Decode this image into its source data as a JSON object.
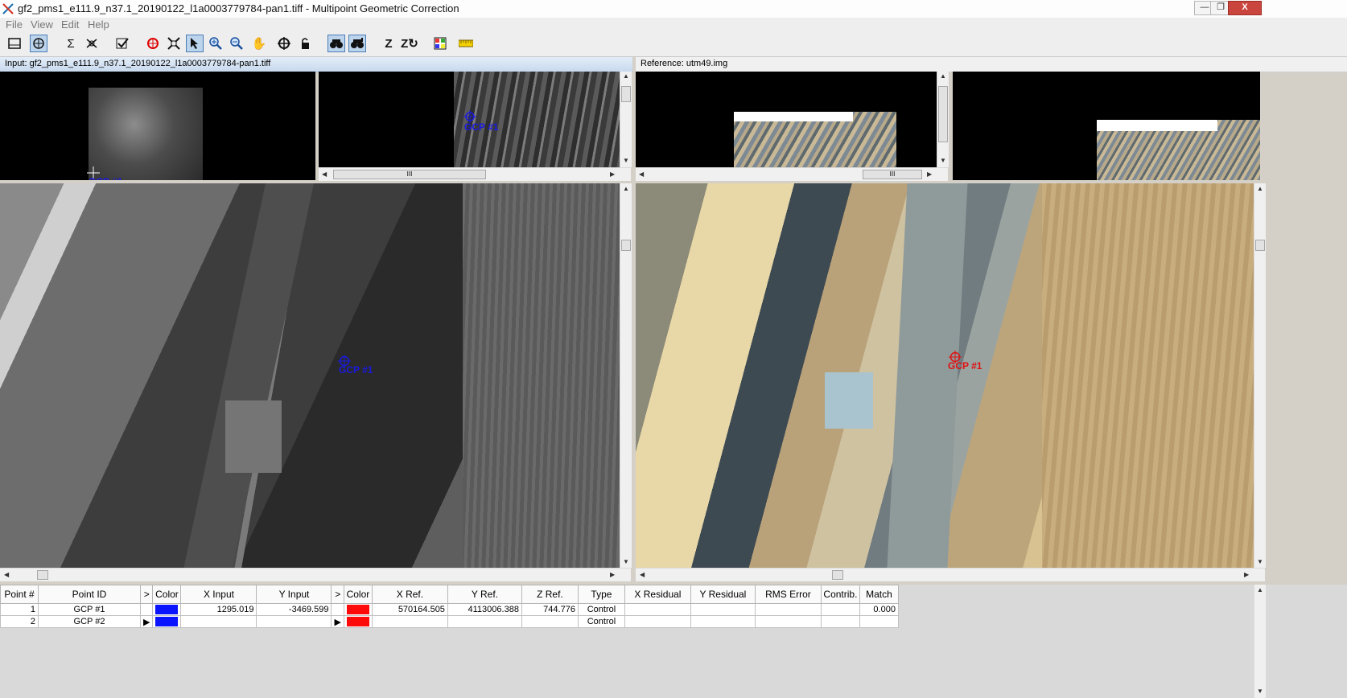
{
  "window": {
    "title": "gf2_pms1_e111.9_n37.1_20190122_l1a0003779784-pan1.tiff - Multipoint Geometric Correction",
    "minimize_symbol": "—",
    "maximize_symbol": "❐",
    "close_symbol": "X"
  },
  "menu": [
    "File",
    "View",
    "Edit",
    "Help"
  ],
  "toolbar_icons": [
    "layout-icon",
    "auto-gcp-icon",
    "sum-icon",
    "gcp-tools-icon",
    "check-icon",
    "color-icon",
    "fit-icon",
    "select-arrow-icon",
    "zoom-in-icon",
    "zoom-out-icon",
    "pan-hand-icon",
    "create-gcp-icon",
    "lock-icon",
    "drive-input-icon",
    "drive-ref-icon",
    "z-value-icon",
    "z-auto-icon",
    "grid-icon",
    "ruler-icon"
  ],
  "input_pane": {
    "header": "Input: gf2_pms1_e111.9_n37.1_20190122_l1a0003779784-pan1.tiff"
  },
  "reference_pane": {
    "header": "Reference: utm49.img"
  },
  "gcp_label": "GCP #1",
  "scrollbar": {
    "up": "▲",
    "down": "▼",
    "left": "◀",
    "right": "▶",
    "grip": "III"
  },
  "colors": {
    "input_gcp": "#1a1ae0",
    "ref_gcp": "#e01010",
    "input_color_swatch": "#0a14ff",
    "ref_color_swatch": "#ff0a0a",
    "selection": "#bcd4ec"
  },
  "table": {
    "headers": [
      "Point #",
      "Point ID",
      ">",
      "Color",
      "X Input",
      "Y Input",
      ">",
      "Color",
      "X Ref.",
      "Y Ref.",
      "Z Ref.",
      "Type",
      "X Residual",
      "Y Residual",
      "RMS Error",
      "Contrib.",
      "Match"
    ],
    "rows": [
      {
        "num": "1",
        "id": "GCP #1",
        "marker": "",
        "x_input": "1295.019",
        "y_input": "-3469.599",
        "marker2": "",
        "x_ref": "570164.505",
        "y_ref": "4113006.388",
        "z_ref": "744.776",
        "type": "Control",
        "x_res": "",
        "y_res": "",
        "rms": "",
        "contrib": "",
        "match": "0.000"
      },
      {
        "num": "2",
        "id": "GCP #2",
        "marker": "▶",
        "x_input": "",
        "y_input": "",
        "marker2": "▶",
        "x_ref": "",
        "y_ref": "",
        "z_ref": "",
        "type": "Control",
        "x_res": "",
        "y_res": "",
        "rms": "",
        "contrib": "",
        "match": ""
      }
    ]
  }
}
